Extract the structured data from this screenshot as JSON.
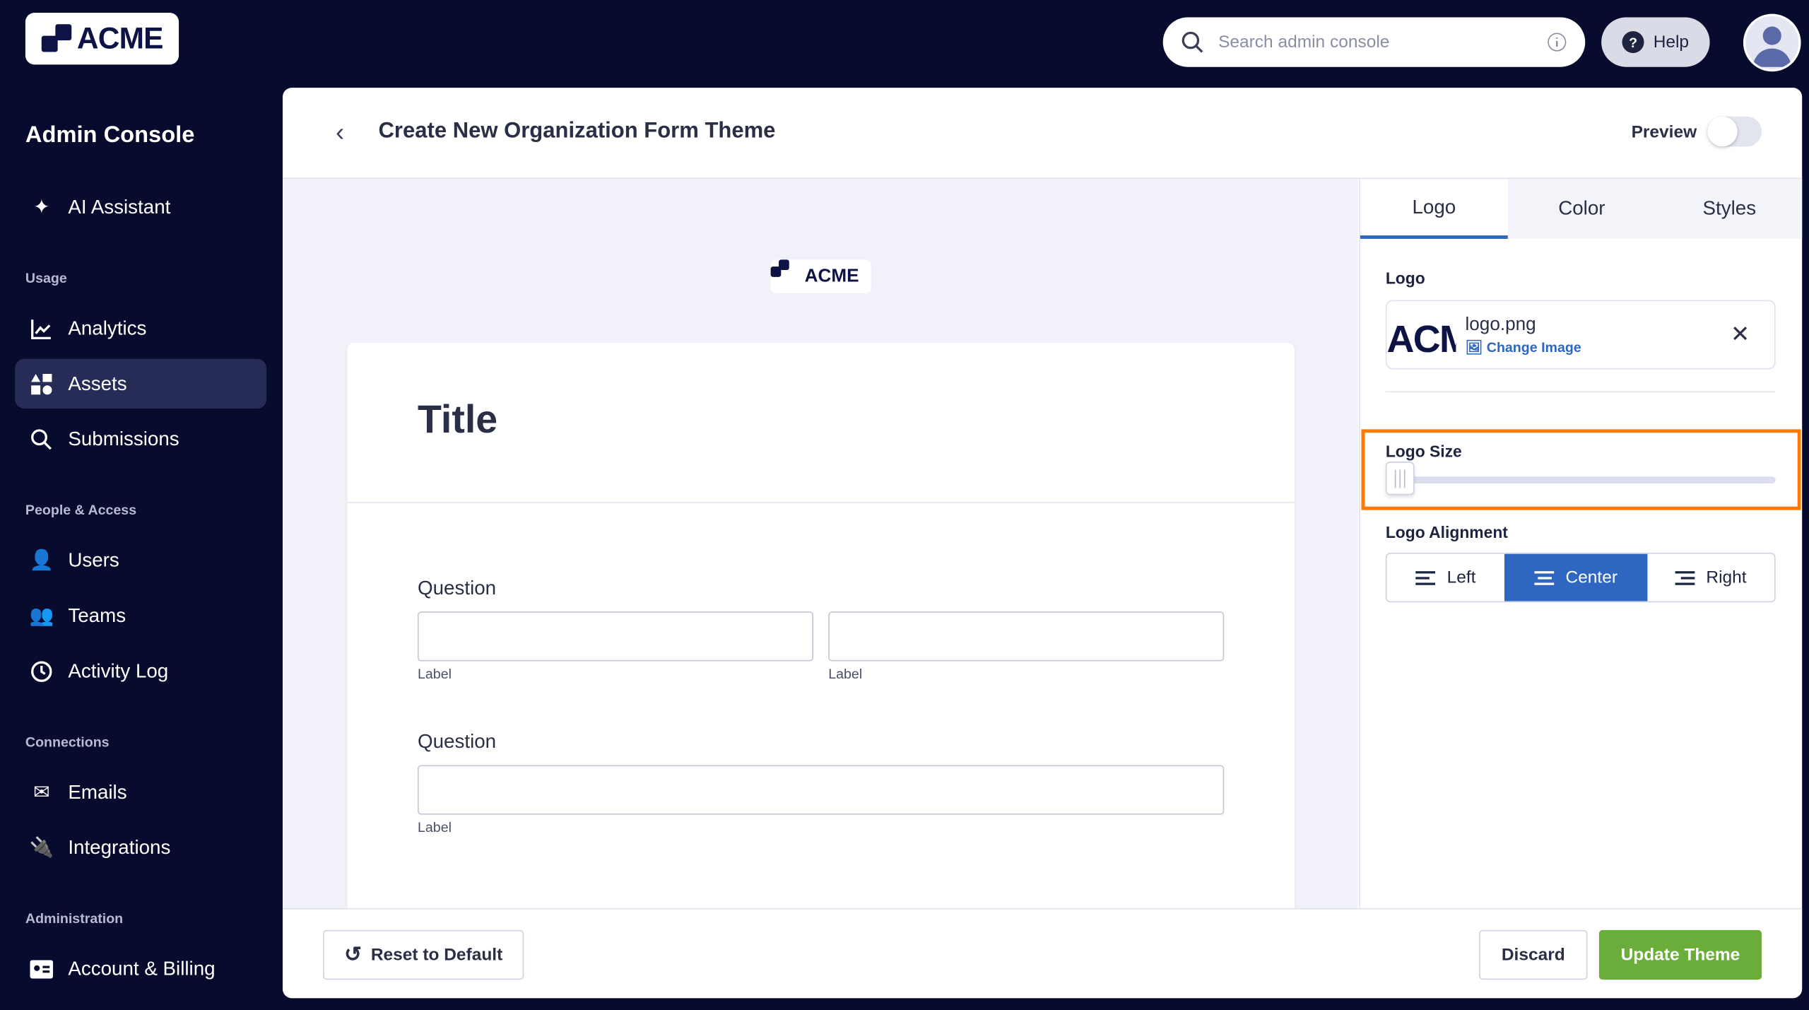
{
  "brand": {
    "logo_text": "ACME"
  },
  "sidebar": {
    "title": "Admin Console",
    "ai": "AI Assistant",
    "sections": [
      "Usage",
      "People & Access",
      "Connections",
      "Administration"
    ],
    "items": {
      "analytics": "Analytics",
      "assets": "Assets",
      "submissions": "Submissions",
      "users": "Users",
      "teams": "Teams",
      "activity": "Activity Log",
      "emails": "Emails",
      "integrations": "Integrations",
      "billing": "Account & Billing"
    }
  },
  "topbar": {
    "search_placeholder": "Search admin console",
    "help": "Help"
  },
  "header": {
    "title": "Create New Organization Form Theme",
    "preview_label": "Preview",
    "preview_on": false
  },
  "preview": {
    "logo_text": "ACME",
    "form_title": "Title",
    "questions": [
      {
        "label": "Question",
        "sublabels": [
          "Label",
          "Label"
        ]
      },
      {
        "label": "Question",
        "sublabels": [
          "Label"
        ]
      }
    ]
  },
  "panel": {
    "tabs": [
      "Logo",
      "Color",
      "Styles"
    ],
    "active_tab": "Logo",
    "logo_label": "Logo",
    "logo_thumb_text": "ACME",
    "file_name": "logo.png",
    "change_image": "Change Image",
    "logo_size_label": "Logo Size",
    "logo_size_value": 0,
    "alignment_label": "Logo Alignment",
    "alignment_options": [
      "Left",
      "Center",
      "Right"
    ],
    "alignment_selected": "Center"
  },
  "footer": {
    "reset": "Reset to Default",
    "discard": "Discard",
    "update": "Update Theme"
  },
  "colors": {
    "accent": "#2e66c0",
    "success": "#6aad3a",
    "highlight": "#ff7a00",
    "sidebar": "#070c2e"
  }
}
